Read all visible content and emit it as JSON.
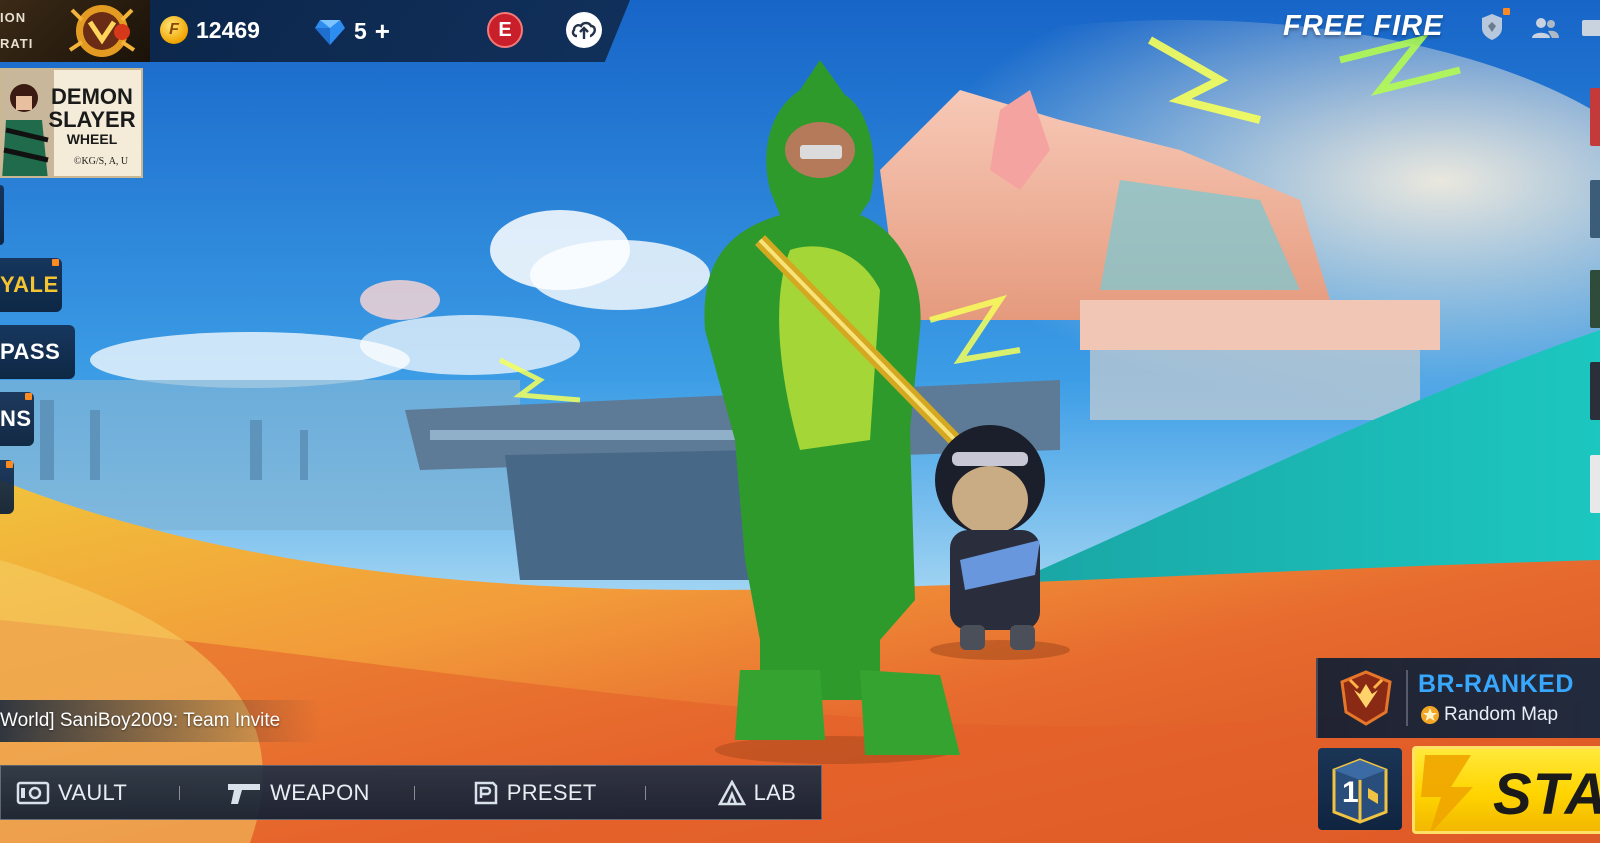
{
  "top_bar": {
    "rank_text_top": "ION",
    "rank_text_bottom": "RATI",
    "gold_amount": "12469",
    "diamond_amount": "5",
    "diamond_plus": "+",
    "gold_icon_letter": "F",
    "elite_badge_letter": "E",
    "icons": [
      "gold-coin-icon",
      "diamond-icon",
      "elite-pass-badge-icon",
      "cloud-upload-icon"
    ]
  },
  "logo": {
    "text": "FREE FIRE"
  },
  "top_right_icons": [
    "shield-icon",
    "friends-icon",
    "mail-icon"
  ],
  "event_banner": {
    "line1": "DEMON",
    "line2": "SLAYER",
    "line3": "WHEEL",
    "copyright": "©KG/S, A, U"
  },
  "side_menu": {
    "items": [
      {
        "label": "YALE",
        "notification": true
      },
      {
        "label": "PASS",
        "notification": false
      },
      {
        "label": "NS",
        "notification": true
      },
      {
        "label": "",
        "notification": true
      }
    ]
  },
  "chat": {
    "message": "World] SaniBoy2009: Team Invite"
  },
  "bottom_nav": {
    "items": [
      {
        "label": "VAULT",
        "icon": "vault-icon"
      },
      {
        "label": "WEAPON",
        "icon": "pistol-icon"
      },
      {
        "label": "PRESET",
        "icon": "preset-icon"
      },
      {
        "label": "LAB",
        "icon": "lab-icon"
      }
    ]
  },
  "mode": {
    "title": "BR-RANKED",
    "subtitle": "Random Map",
    "icon": "ranked-emblem-icon"
  },
  "crate": {
    "label": "1"
  },
  "start": {
    "label": "STAR"
  },
  "colors": {
    "mode_title": "#38a8ff",
    "start_button": "#ffd400",
    "gold": "#f0a400",
    "notification": "#ff8a1f"
  }
}
